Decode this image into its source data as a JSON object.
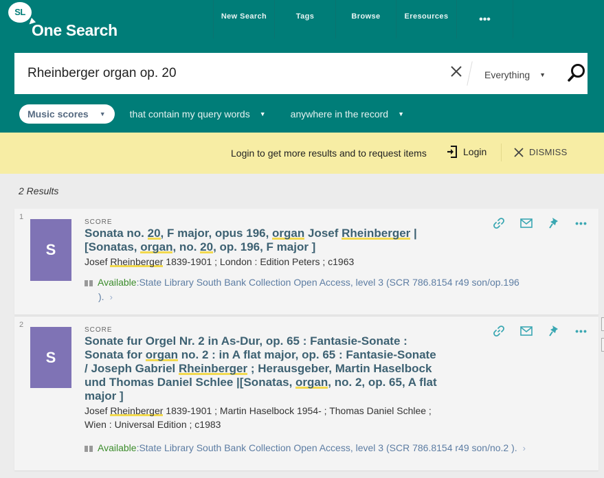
{
  "brand": {
    "logo_badge": "SL",
    "title": "One Search"
  },
  "nav": {
    "items": [
      {
        "label": "New Search"
      },
      {
        "label": "Tags"
      },
      {
        "label": "Browse"
      },
      {
        "label": "Eresources"
      },
      {
        "label": "•••"
      }
    ]
  },
  "search": {
    "query": "Rheinberger organ op. 20",
    "clear_icon": "close-icon",
    "scope": "Everything",
    "search_icon": "magnifier-icon"
  },
  "filters": {
    "resource_type": "Music scores",
    "match_mode": "that contain my query words",
    "field": "anywhere in the record"
  },
  "banner": {
    "message": "Login to get more results and to request items",
    "login_label": "Login",
    "dismiss_label": "DISMISS"
  },
  "results": {
    "count_label": "2 Results",
    "items": [
      {
        "number": "1",
        "thumb_letter": "S",
        "type": "SCORE",
        "title_parts": [
          {
            "t": "Sonata no. ",
            "h": false
          },
          {
            "t": "20",
            "h": true
          },
          {
            "t": ", F major, opus 196, ",
            "h": false
          },
          {
            "t": "organ",
            "h": true
          },
          {
            "t": " Josef ",
            "h": false
          },
          {
            "t": "Rheinberger",
            "h": true
          },
          {
            "t": " |[Sonatas, ",
            "h": false
          },
          {
            "t": "organ",
            "h": true
          },
          {
            "t": ", no. ",
            "h": false
          },
          {
            "t": "20",
            "h": true
          },
          {
            "t": ", op. 196, F major ]",
            "h": false
          }
        ],
        "meta_parts": [
          {
            "t": "Josef ",
            "h": false
          },
          {
            "t": "Rheinberger",
            "h": true
          },
          {
            "t": " 1839-1901 ; London : Edition Peters ; c1963",
            "h": false
          }
        ],
        "availability_status": "Available",
        "availability_location": "State Library South Bank Collection  Open Access, level 3 (SCR 786.8154 r49 son/op.196",
        "availability_tail": ")."
      },
      {
        "number": "2",
        "thumb_letter": "S",
        "type": "SCORE",
        "title_parts": [
          {
            "t": "Sonate fur Orgel Nr. 2 in As-Dur, op. 65 : Fantasie-Sonate : Sonata for ",
            "h": false
          },
          {
            "t": "organ",
            "h": true
          },
          {
            "t": " no. 2 : in A flat major, op. 65 : Fantasie-Sonate / Joseph Gabriel ",
            "h": false
          },
          {
            "t": "Rheinberger",
            "h": true
          },
          {
            "t": " ; Herausgeber, Martin Haselbock und Thomas Daniel Schlee |[Sonatas, ",
            "h": false
          },
          {
            "t": "organ",
            "h": true
          },
          {
            "t": ", no. 2, op. 65, A flat major ]",
            "h": false
          }
        ],
        "meta_parts": [
          {
            "t": "Josef ",
            "h": false
          },
          {
            "t": "Rheinberger",
            "h": true
          },
          {
            "t": " 1839-1901 ; Martin Haselbock 1954- ; Thomas Daniel Schlee ; Wien : Universal Edition ; c1983",
            "h": false
          }
        ],
        "availability_status": "Available",
        "availability_location": "State Library South Bank Collection  Open Access, level 3 (SCR 786.8154 r49 son/no.2 ).",
        "availability_tail": ""
      }
    ],
    "actions": [
      {
        "icon": "link-icon"
      },
      {
        "icon": "email-icon"
      },
      {
        "icon": "pin-icon"
      },
      {
        "icon": "more-icon",
        "label": "•••"
      }
    ]
  },
  "colors": {
    "brand_teal": "#007d78",
    "banner_yellow": "#f7eda4",
    "thumb_purple": "#7f73b5",
    "title_blue": "#3d6172",
    "available_green": "#3b8c2b",
    "location_blue": "#5d7da3",
    "action_teal": "#3aa7b2",
    "highlight": "#f2d94e"
  }
}
